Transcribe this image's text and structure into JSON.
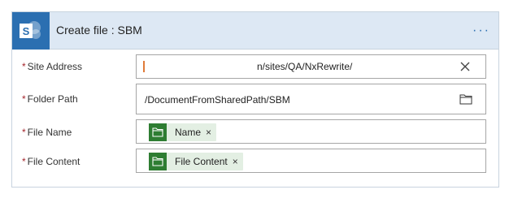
{
  "header": {
    "logo_letter": "S",
    "title": "Create file : SBM",
    "menu_label": "···"
  },
  "fields": [
    {
      "id": "site_address",
      "label": "Site Address",
      "value": "n/sites/QA/NxRewrite/",
      "icon": "clear-x-icon"
    },
    {
      "id": "folder_path",
      "label": "Folder Path",
      "value": "/DocumentFromSharedPath/SBM",
      "icon": "folder-icon"
    },
    {
      "id": "file_name",
      "label": "File Name",
      "token": "Name",
      "token_icon": "folder-dynamic-content-icon"
    },
    {
      "id": "file_content",
      "label": "File Content",
      "token": "File Content",
      "token_icon": "folder-dynamic-content-icon"
    }
  ],
  "required_mark": "*",
  "token_remove_label": "×",
  "colors": {
    "header_bg": "#dde8f4",
    "logo_bg": "#2b6fb1",
    "token_bg": "#e3efe3",
    "token_icon_bg": "#2e7d32",
    "required": "#a4262c"
  }
}
